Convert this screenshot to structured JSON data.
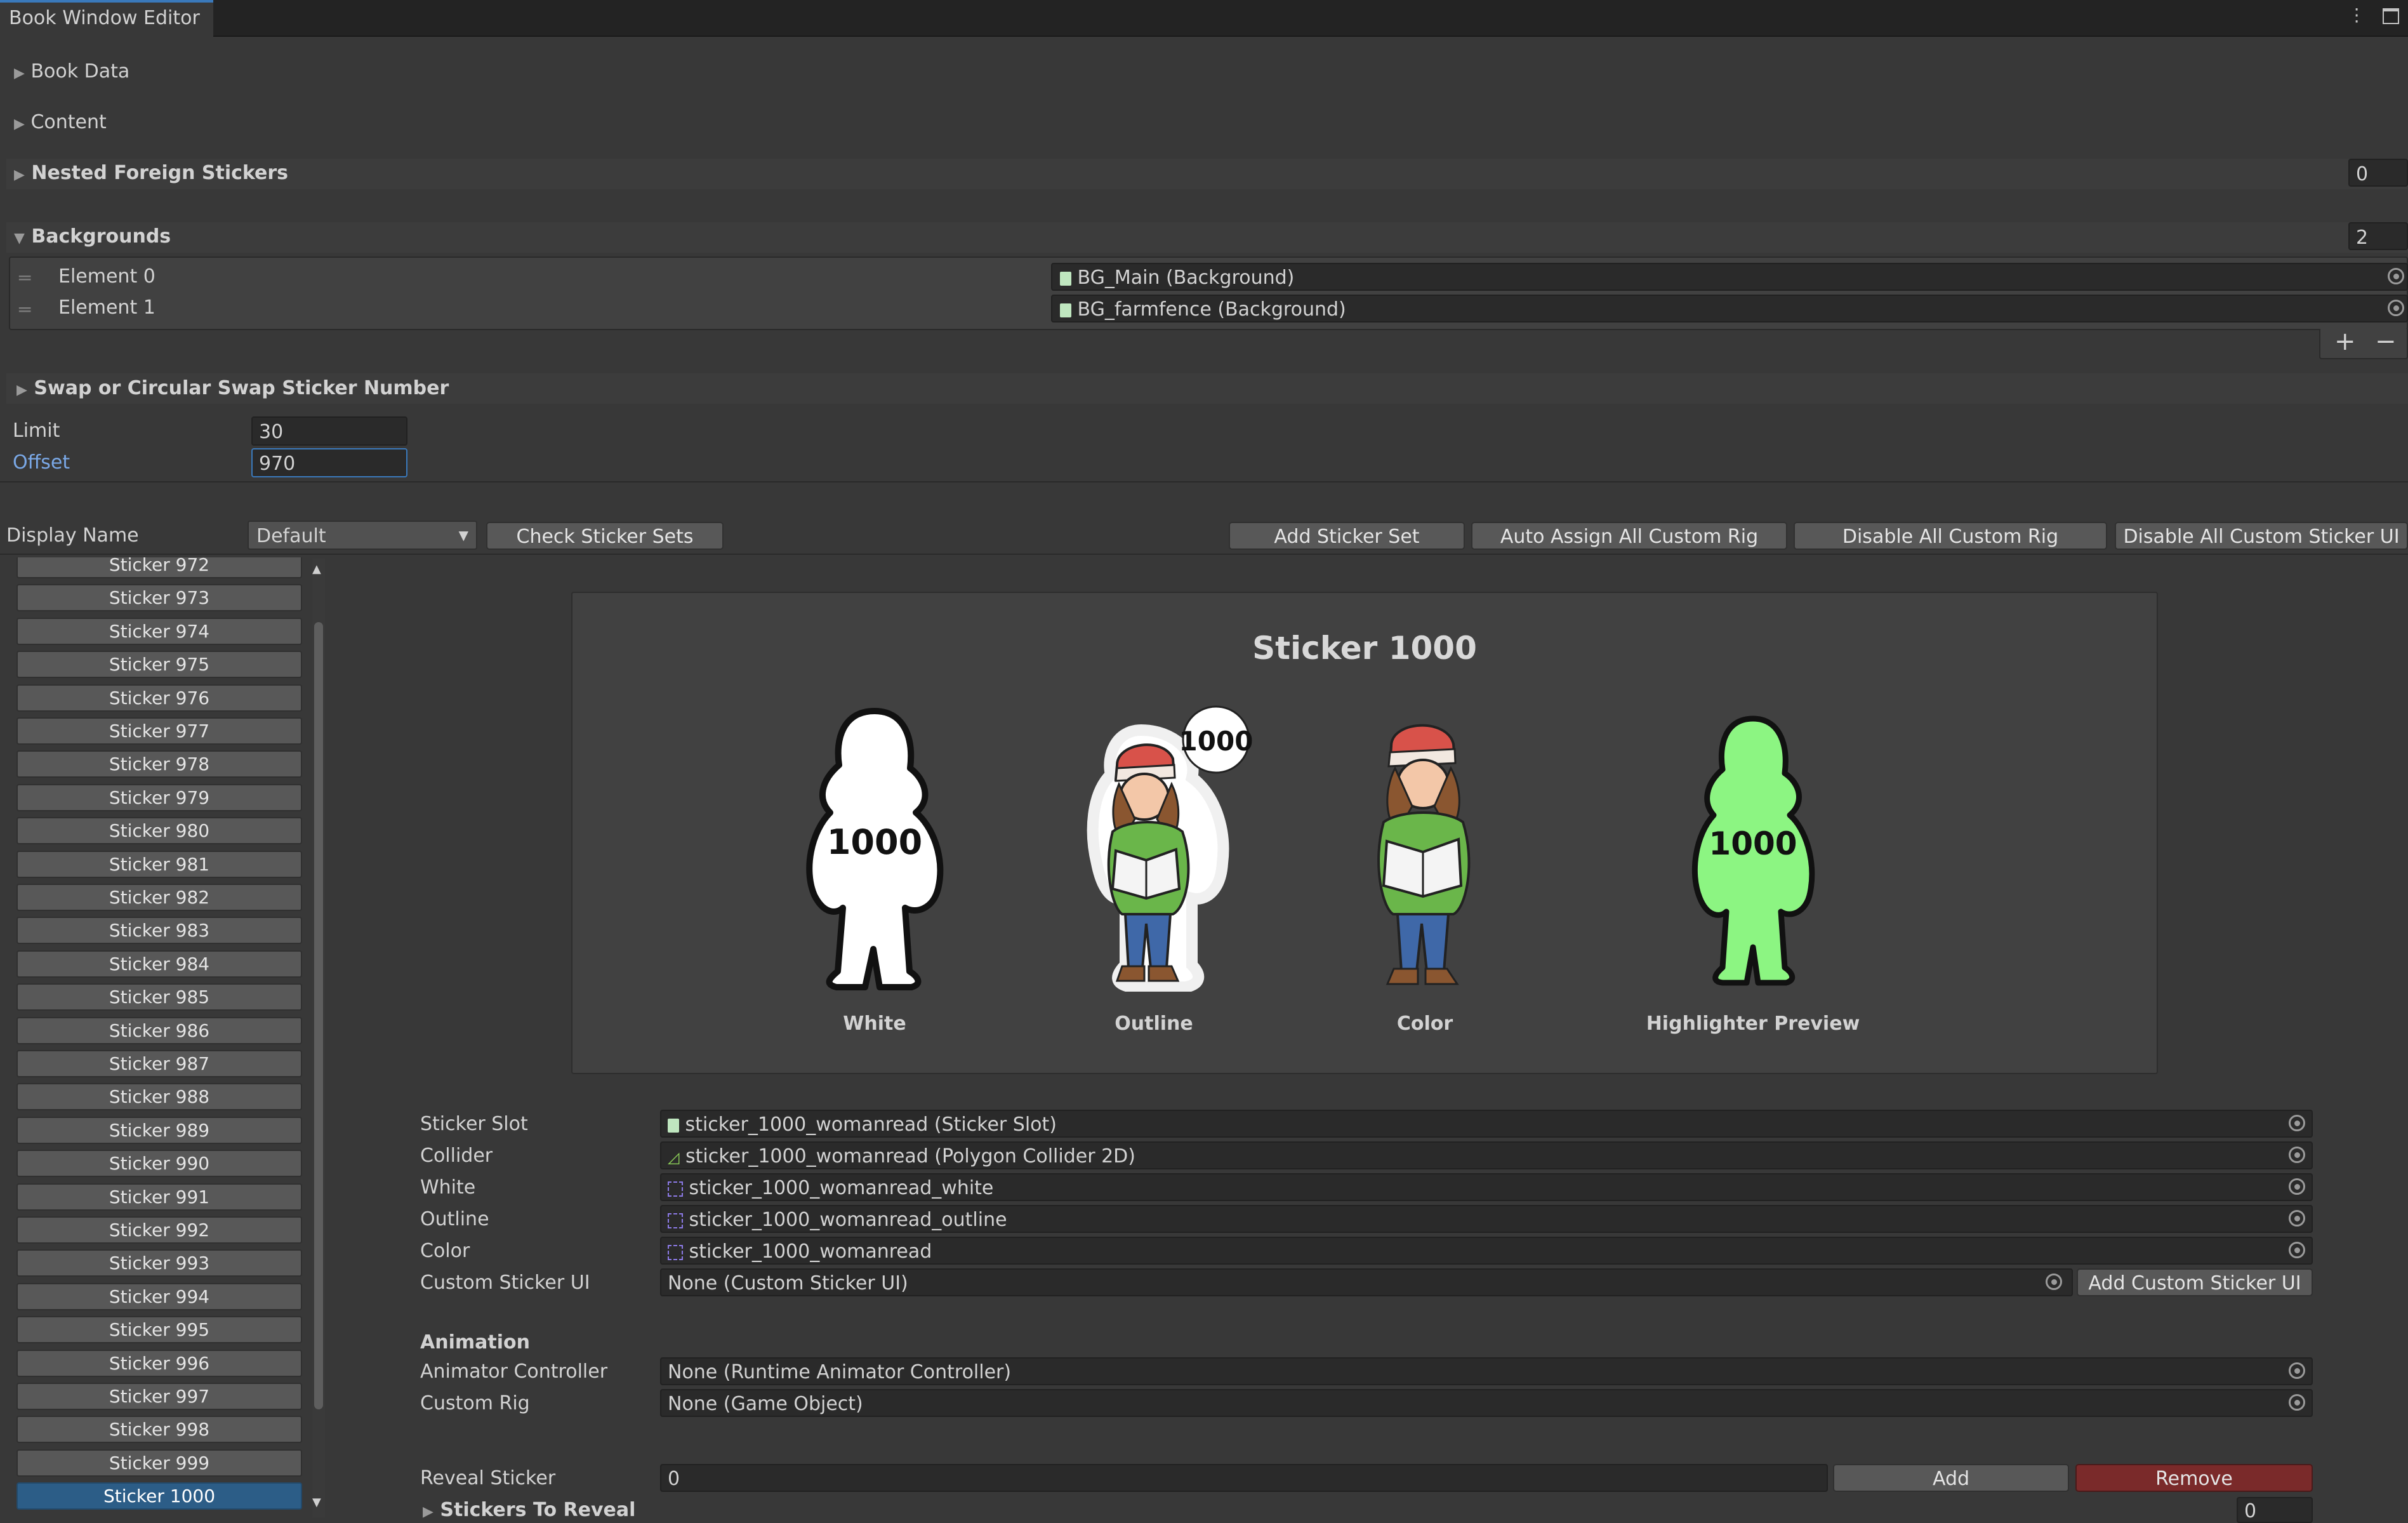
{
  "window": {
    "tab_title": "Book Window Editor",
    "menu_icon": "kebab-menu-icon",
    "maximize_icon": "maximize-icon"
  },
  "sections": {
    "book_data": "Book Data",
    "content": "Content",
    "nested_foreign_stickers": {
      "label": "Nested Foreign Stickers",
      "count": "0"
    },
    "backgrounds": {
      "label": "Backgrounds",
      "count": "2",
      "elements": [
        {
          "label": "Element 0",
          "value": "BG_Main (Background)"
        },
        {
          "label": "Element 1",
          "value": "BG_farmfence (Background)"
        }
      ],
      "add_icon": "plus-icon",
      "remove_icon": "minus-icon"
    },
    "swap": {
      "label": "Swap or Circular Swap Sticker Number"
    }
  },
  "limit": {
    "label": "Limit",
    "value": "30"
  },
  "offset": {
    "label": "Offset",
    "value": "970"
  },
  "toolbar": {
    "display_name_label": "Display Name",
    "display_name_value": "Default",
    "check_sticker_sets": "Check Sticker Sets",
    "add_sticker_set": "Add Sticker Set",
    "auto_assign": "Auto Assign All Custom Rig",
    "disable_custom_rig": "Disable All Custom Rig",
    "disable_custom_ui": "Disable All Custom Sticker UI"
  },
  "sticker_list": [
    "Sticker 972",
    "Sticker 973",
    "Sticker 974",
    "Sticker 975",
    "Sticker 976",
    "Sticker 977",
    "Sticker 978",
    "Sticker 979",
    "Sticker 980",
    "Sticker 981",
    "Sticker 982",
    "Sticker 983",
    "Sticker 984",
    "Sticker 985",
    "Sticker 986",
    "Sticker 987",
    "Sticker 988",
    "Sticker 989",
    "Sticker 990",
    "Sticker 991",
    "Sticker 992",
    "Sticker 993",
    "Sticker 994",
    "Sticker 995",
    "Sticker 996",
    "Sticker 997",
    "Sticker 998",
    "Sticker 999",
    "Sticker 1000"
  ],
  "selected_sticker": "Sticker 1000",
  "preview": {
    "title": "Sticker 1000",
    "number": "1000",
    "labels": {
      "white": "White",
      "outline": "Outline",
      "color": "Color",
      "highlighter": "Highlighter Preview"
    },
    "colors": {
      "highlighter": "#8cf582",
      "coat": "#6ab64a",
      "hat": "#d8524a",
      "jeans": "#3f68a8",
      "hair": "#8a5630"
    }
  },
  "properties": {
    "sticker_slot": {
      "label": "Sticker Slot",
      "value": "sticker_1000_womanread (Sticker Slot)"
    },
    "collider": {
      "label": "Collider",
      "value": "sticker_1000_womanread (Polygon Collider 2D)"
    },
    "white": {
      "label": "White",
      "value": "sticker_1000_womanread_white"
    },
    "outline": {
      "label": "Outline",
      "value": "sticker_1000_womanread_outline"
    },
    "color": {
      "label": "Color",
      "value": "sticker_1000_womanread"
    },
    "custom_sticker_ui": {
      "label": "Custom Sticker UI",
      "value": "None (Custom Sticker UI)",
      "button": "Add Custom Sticker UI"
    }
  },
  "animation": {
    "heading": "Animation",
    "animator_controller": {
      "label": "Animator Controller",
      "value": "None (Runtime Animator Controller)"
    },
    "custom_rig": {
      "label": "Custom Rig",
      "value": "None (Game Object)"
    }
  },
  "reveal": {
    "label": "Reveal Sticker",
    "value": "0",
    "add": "Add",
    "remove": "Remove",
    "stickers_to_reveal": "Stickers To Reveal",
    "stickers_to_reveal_count": "0"
  }
}
